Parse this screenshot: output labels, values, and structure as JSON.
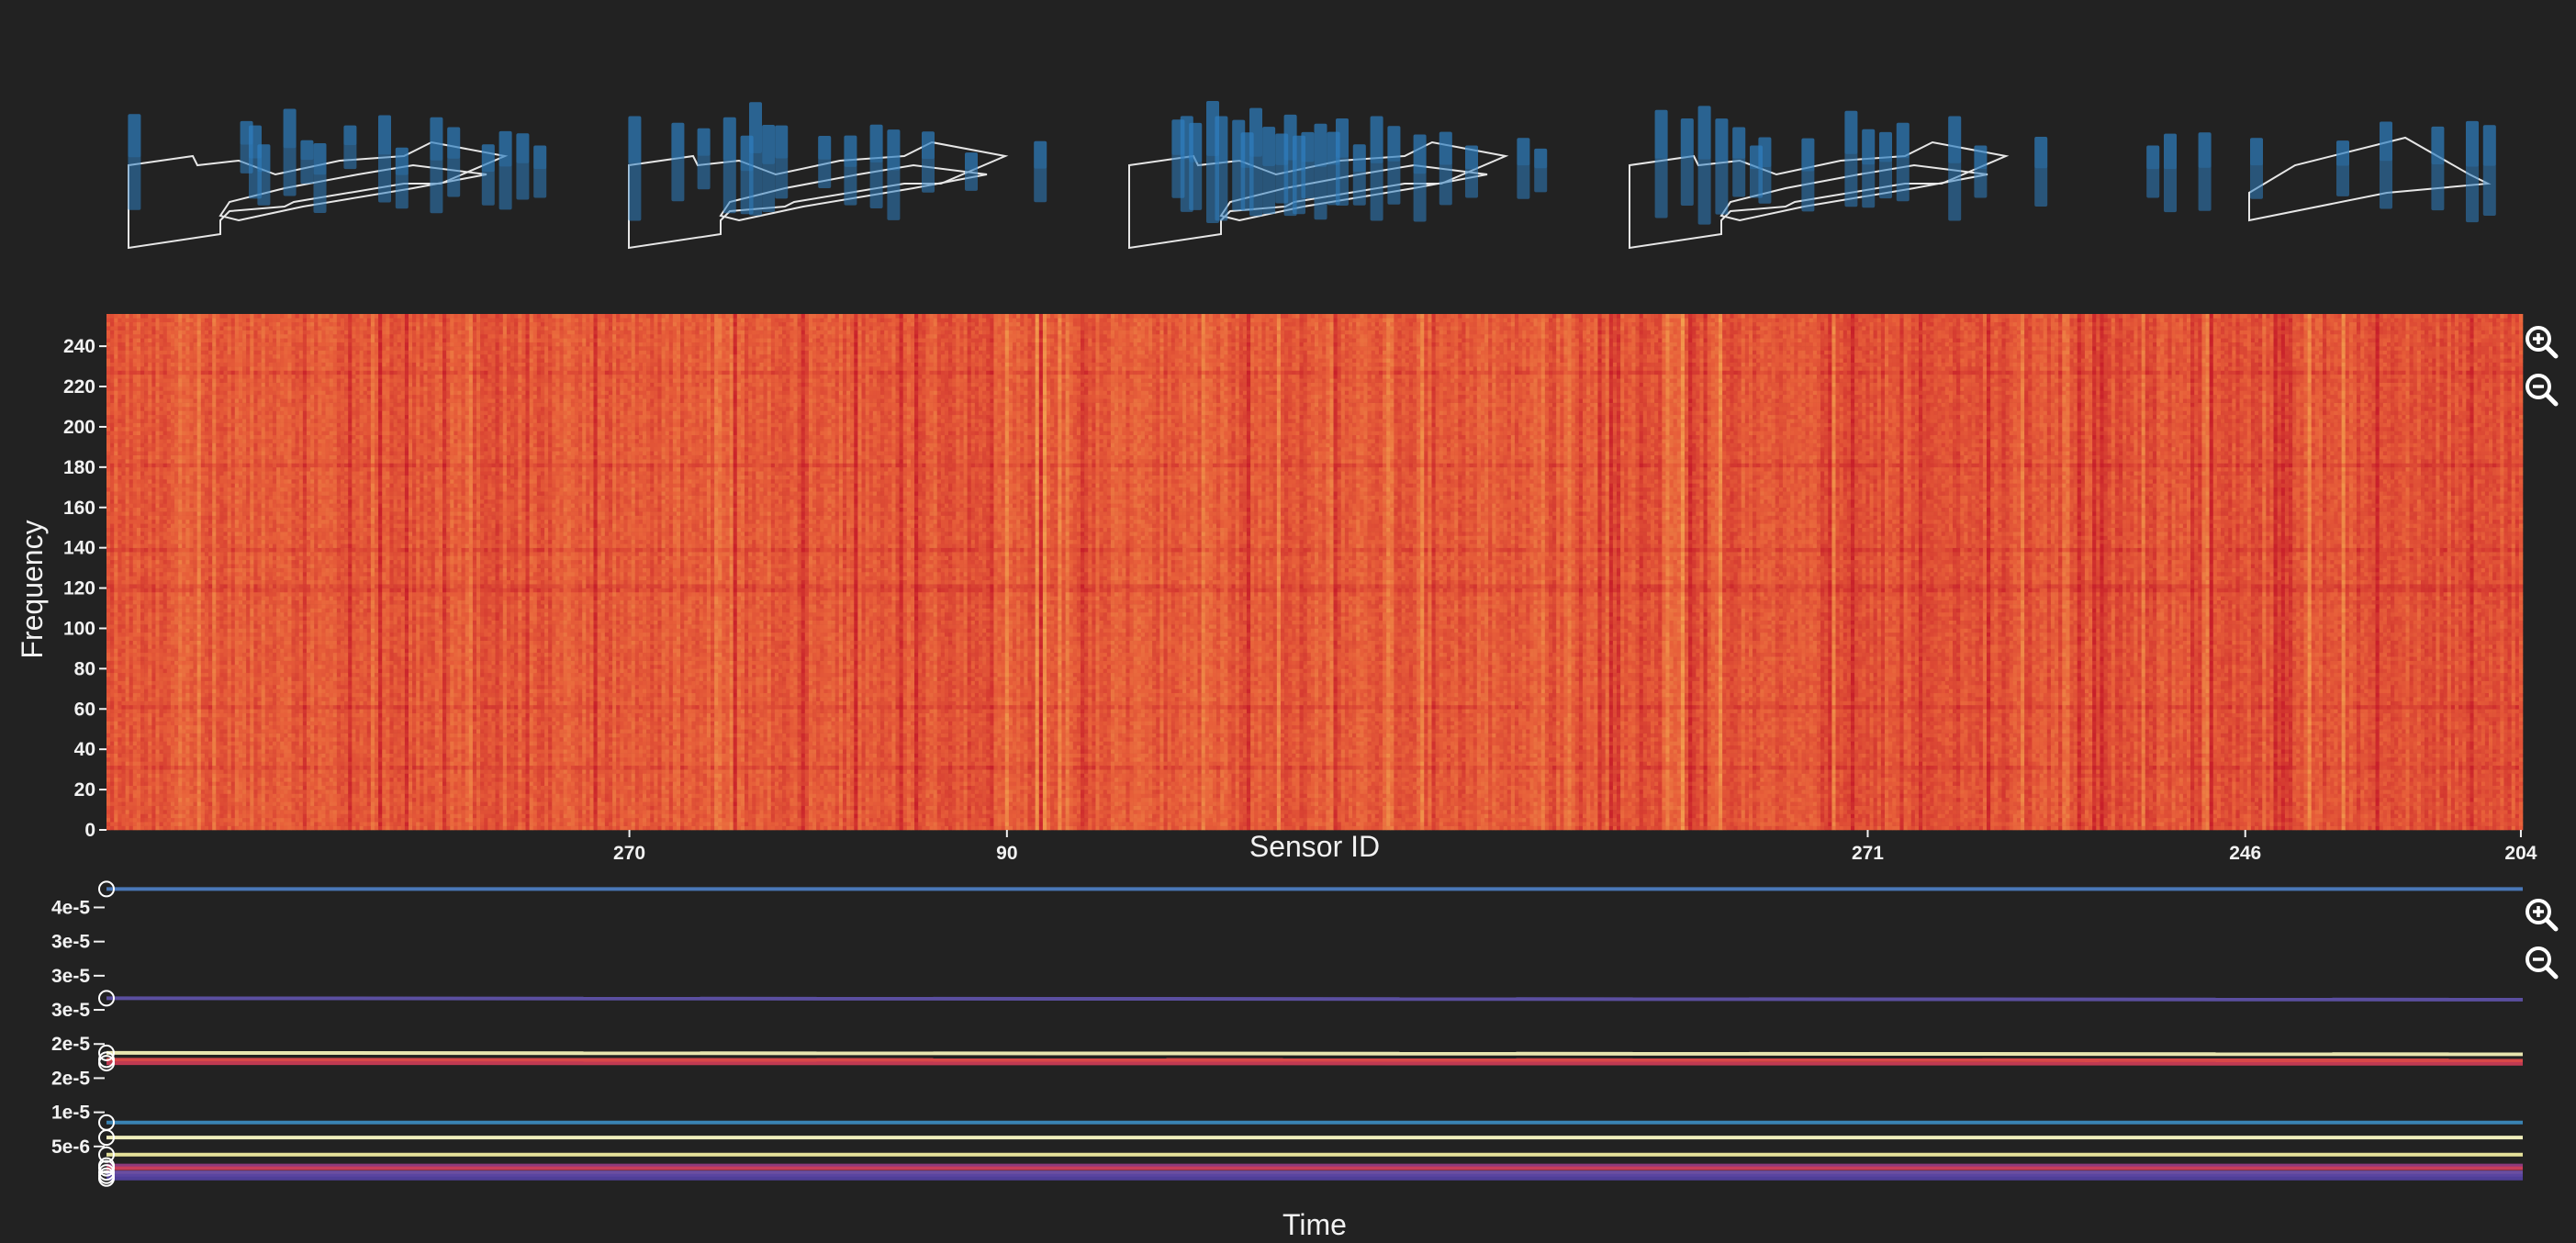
{
  "colors": {
    "background": "#222222",
    "bar": "#2f7fc1",
    "outline": "#e6e6e6",
    "heat_low": "#f3a04f",
    "heat_mid": "#e8603a",
    "heat_high": "#c8202a"
  },
  "icons": {
    "zoom_in": "zoom-in-icon",
    "zoom_out": "zoom-out-icon"
  },
  "floorplans": [
    {
      "variant": "full",
      "bars": [
        [
          0.02,
          0.55,
          0.55
        ],
        [
          0.28,
          0.78,
          0.3
        ],
        [
          0.3,
          0.55,
          0.42
        ],
        [
          0.32,
          0.35,
          0.35
        ],
        [
          0.38,
          0.7,
          0.5
        ],
        [
          0.42,
          0.55,
          0.25
        ],
        [
          0.45,
          0.3,
          0.4
        ],
        [
          0.52,
          0.78,
          0.25
        ],
        [
          0.6,
          0.6,
          0.5
        ],
        [
          0.64,
          0.3,
          0.35
        ],
        [
          0.72,
          0.5,
          0.55
        ],
        [
          0.76,
          0.55,
          0.4
        ],
        [
          0.84,
          0.35,
          0.35
        ],
        [
          0.88,
          0.42,
          0.45
        ],
        [
          0.92,
          0.48,
          0.38
        ],
        [
          0.96,
          0.4,
          0.3
        ]
      ]
    },
    {
      "variant": "full",
      "bars": [
        [
          0.02,
          0.45,
          0.6
        ],
        [
          0.12,
          0.55,
          0.45
        ],
        [
          0.18,
          0.6,
          0.35
        ],
        [
          0.24,
          0.5,
          0.55
        ],
        [
          0.28,
          0.35,
          0.45
        ],
        [
          0.3,
          0.6,
          0.65
        ],
        [
          0.33,
          0.45,
          0.5
        ],
        [
          0.36,
          0.55,
          0.42
        ],
        [
          0.46,
          0.55,
          0.3
        ],
        [
          0.52,
          0.42,
          0.4
        ],
        [
          0.58,
          0.48,
          0.48
        ],
        [
          0.62,
          0.35,
          0.52
        ],
        [
          0.7,
          0.55,
          0.35
        ],
        [
          0.8,
          0.4,
          0.22
        ],
        [
          0.96,
          0.4,
          0.35
        ]
      ]
    },
    {
      "variant": "full",
      "bars": [
        [
          0.12,
          0.6,
          0.45
        ],
        [
          0.14,
          0.52,
          0.55
        ],
        [
          0.16,
          0.48,
          0.5
        ],
        [
          0.2,
          0.55,
          0.7
        ],
        [
          0.22,
          0.45,
          0.6
        ],
        [
          0.26,
          0.5,
          0.52
        ],
        [
          0.28,
          0.4,
          0.45
        ],
        [
          0.3,
          0.55,
          0.62
        ],
        [
          0.33,
          0.42,
          0.5
        ],
        [
          0.36,
          0.45,
          0.4
        ],
        [
          0.38,
          0.5,
          0.58
        ],
        [
          0.4,
          0.35,
          0.45
        ],
        [
          0.42,
          0.5,
          0.38
        ],
        [
          0.45,
          0.4,
          0.55
        ],
        [
          0.48,
          0.45,
          0.42
        ],
        [
          0.5,
          0.55,
          0.5
        ],
        [
          0.54,
          0.35,
          0.35
        ],
        [
          0.58,
          0.45,
          0.6
        ],
        [
          0.62,
          0.5,
          0.45
        ],
        [
          0.68,
          0.3,
          0.5
        ],
        [
          0.74,
          0.45,
          0.42
        ],
        [
          0.8,
          0.4,
          0.3
        ],
        [
          0.92,
          0.45,
          0.35
        ],
        [
          0.96,
          0.42,
          0.25
        ]
      ]
    },
    {
      "variant": "full",
      "bars": [
        [
          0.08,
          0.52,
          0.62
        ],
        [
          0.14,
          0.55,
          0.5
        ],
        [
          0.18,
          0.5,
          0.68
        ],
        [
          0.22,
          0.48,
          0.55
        ],
        [
          0.26,
          0.55,
          0.4
        ],
        [
          0.3,
          0.4,
          0.3
        ],
        [
          0.32,
          0.42,
          0.38
        ],
        [
          0.42,
          0.35,
          0.42
        ],
        [
          0.52,
          0.6,
          0.55
        ],
        [
          0.56,
          0.45,
          0.45
        ],
        [
          0.6,
          0.5,
          0.38
        ],
        [
          0.64,
          0.55,
          0.45
        ],
        [
          0.76,
          0.45,
          0.6
        ],
        [
          0.82,
          0.4,
          0.3
        ],
        [
          0.96,
          0.4,
          0.4
        ]
      ]
    },
    {
      "variant": "partial",
      "bars": [
        [
          0.06,
          0.4,
          0.3
        ],
        [
          0.1,
          0.38,
          0.45
        ],
        [
          0.18,
          0.4,
          0.45
        ],
        [
          0.3,
          0.45,
          0.35
        ],
        [
          0.5,
          0.45,
          0.32
        ],
        [
          0.6,
          0.5,
          0.5
        ],
        [
          0.72,
          0.45,
          0.48
        ],
        [
          0.8,
          0.4,
          0.58
        ],
        [
          0.84,
          0.42,
          0.52
        ]
      ]
    }
  ],
  "chart_data": [
    {
      "type": "heatmap",
      "title": "",
      "xlabel": "Sensor ID",
      "ylabel": "Frequency",
      "x_tick_labels": [
        {
          "label": "270",
          "column": 138
        },
        {
          "label": "90",
          "column": 238
        },
        {
          "label": "271",
          "column": 466
        },
        {
          "label": "246",
          "column": 566
        },
        {
          "label": "204",
          "column": 639
        }
      ],
      "y_ticks": [
        0,
        20,
        40,
        60,
        80,
        100,
        120,
        140,
        160,
        180,
        200,
        220,
        240
      ],
      "ylim": [
        0,
        256
      ],
      "n_columns": 640,
      "n_rows": 128,
      "colormap": [
        "#f3a04f",
        "#e8603a",
        "#c8202a"
      ]
    },
    {
      "type": "line",
      "title": "",
      "xlabel": "Time",
      "ylabel": "",
      "y_tick_labels": [
        "4e-5",
        "3e-5",
        "3e-5",
        "3e-5",
        "2e-5",
        "2e-5",
        "1e-5",
        "5e-6"
      ],
      "y_tick_values": [
        4e-05,
        3.5e-05,
        3e-05,
        2.5e-05,
        2e-05,
        1.5e-05,
        1e-05,
        5e-06
      ],
      "ylim": [
        0,
        4.45e-05
      ],
      "series": [
        {
          "color": "#4a78b8",
          "values": [
            4.27e-05,
            4.27e-05
          ]
        },
        {
          "color": "#5b4fa0",
          "values": [
            2.67e-05,
            2.65e-05
          ]
        },
        {
          "color": "#e9e6b0",
          "values": [
            1.87e-05,
            1.85e-05
          ]
        },
        {
          "color": "#d84848",
          "values": [
            1.77e-05,
            1.76e-05
          ]
        },
        {
          "color": "#c03a52",
          "values": [
            1.72e-05,
            1.71e-05
          ]
        },
        {
          "color": "#3a83b3",
          "values": [
            8.5e-06,
            8.5e-06
          ]
        },
        {
          "color": "#f0eebc",
          "values": [
            6.3e-06,
            6.3e-06
          ]
        },
        {
          "color": "#e6e29a",
          "values": [
            3.8e-06,
            3.8e-06
          ]
        },
        {
          "color": "#8e3a7c",
          "values": [
            2.2e-06,
            2.2e-06
          ]
        },
        {
          "color": "#c83d5a",
          "values": [
            1.8e-06,
            1.8e-06
          ]
        },
        {
          "color": "#6b4ea0",
          "values": [
            1.2e-06,
            1.2e-06
          ]
        },
        {
          "color": "#5a45a0",
          "values": [
            7e-07,
            7e-07
          ]
        },
        {
          "color": "#4f3f98",
          "values": [
            3e-07,
            3e-07
          ]
        }
      ]
    }
  ]
}
